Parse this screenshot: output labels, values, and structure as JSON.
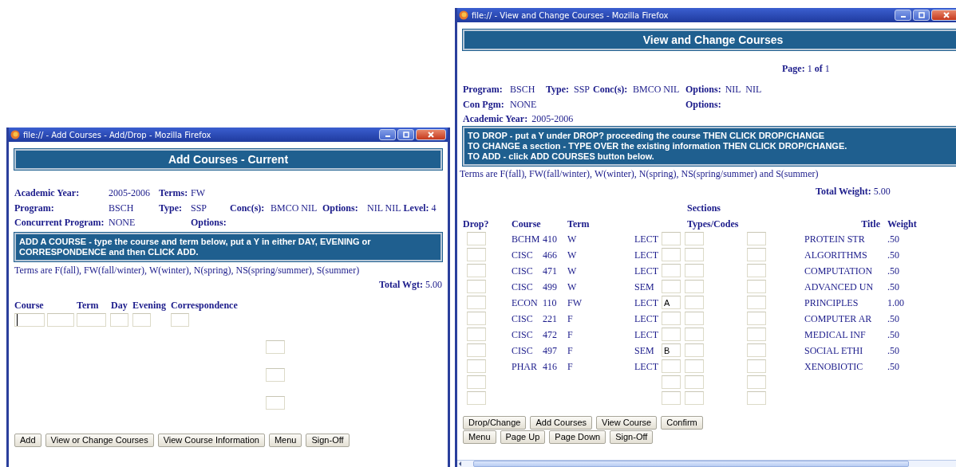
{
  "add_window": {
    "title": "file:// - Add Courses - Add/Drop - Mozilla Firefox",
    "heading": "Add Courses - Current",
    "info_rows": [
      {
        "cells": [
          {
            "kind": "pair",
            "label": "Academic Year:",
            "value": "2005-2006"
          },
          {
            "kind": "pair",
            "label": "Terms:",
            "value": "FW"
          }
        ]
      },
      {
        "cells": [
          {
            "kind": "pair",
            "label": "Program:",
            "value": "BSCH"
          },
          {
            "kind": "pair",
            "label": "Type:",
            "value": "SSP"
          },
          {
            "kind": "pair",
            "label": "Conc(s):",
            "value": "BMCO NIL"
          },
          {
            "kind": "pair",
            "label": "Options:",
            "value": "NIL NIL"
          },
          {
            "kind": "pair",
            "label": "Level:",
            "value": "4"
          }
        ]
      },
      {
        "cells": [
          {
            "kind": "pair",
            "label": "Concurrent Program:",
            "value": "NONE"
          },
          {
            "kind": "spacer"
          },
          {
            "kind": "pair",
            "label": "Options:"
          }
        ]
      }
    ],
    "instruction": "ADD A COURSE - type the course and term below, put a Y in either DAY, EVENING or CORRESPONDENCE and then CLICK ADD.",
    "terms_note": "Terms are F(fall), FW(fall/winter), W(winter), N(spring), NS(spring/summer), S(summer)",
    "total": "**Total Wgt:** 5.00",
    "form_labels": [
      {
        "kind": "course",
        "text": "Course"
      },
      {
        "kind": "term",
        "text": "Term"
      },
      {
        "kind": "day",
        "text": "Day"
      },
      {
        "kind": "evening",
        "text": "Evening"
      },
      {
        "kind": "correspondence",
        "text": "Correspondence"
      }
    ],
    "form_fields": [
      {
        "kind": "course_subject",
        "focused": true
      },
      {
        "kind": "course_number",
        "focused": false
      },
      {
        "kind": "term",
        "focused": false
      },
      {
        "kind": "day",
        "focused": false
      },
      {
        "kind": "evening",
        "focused": false
      },
      {
        "kind": "correspondence",
        "focused": false
      }
    ],
    "extra_fields": [
      {
        "kind": "text"
      },
      {
        "kind": "text"
      },
      {
        "kind": "text"
      }
    ],
    "buttons": [
      "Add",
      "View or Change Courses",
      "View Course Information",
      "Menu",
      "Sign-Off"
    ]
  },
  "view_window": {
    "title": "file:// - View and Change Courses - Mozilla Firefox",
    "heading": "View and Change Courses",
    "page": "**Page:** 1 **of** 1",
    "info_rows": [
      {
        "cells": [
          {
            "kind": "pair",
            "label": "Program:",
            "value": "BSCH"
          },
          {
            "kind": "pair",
            "label": "Type:",
            "value": "SSP"
          },
          {
            "kind": "pair",
            "label": "Conc(s):",
            "value": "BMCO NIL"
          },
          {
            "kind": "pair",
            "label": "Options:",
            "value": "NIL  NIL"
          }
        ]
      },
      {
        "cells": [
          {
            "kind": "pair",
            "label": "Con Pgm:",
            "value": "NONE"
          },
          {
            "kind": "spacer"
          },
          {
            "kind": "pair",
            "label": "Options:"
          }
        ]
      },
      {
        "cells": [
          {
            "kind": "pair",
            "label": "Academic Year:",
            "value": "2005-2006"
          }
        ]
      }
    ],
    "instructions": [
      "TO DROP - put a Y under DROP? proceeding the course THEN CLICK DROP/CHANGE",
      "TO CHANGE a section - TYPE OVER the existing information THEN CLICK DROP/CHANGE.",
      "TO ADD - click ADD COURSES button below."
    ],
    "terms_note": "Terms are F(fall), FW(fall/winter), W(winter), N(spring), NS(spring/summer) and S(summer)",
    "total": "**Total Weight:** 5.00",
    "sections_heading": "Sections",
    "columns": {
      "drop": "Drop?",
      "course": "Course",
      "term": "Term",
      "types": "Types/Codes",
      "title": "Title",
      "weight": "Weight"
    },
    "rows": [
      {
        "kind": "course",
        "subject": "BCHM",
        "number": "410",
        "term": "W",
        "type": "LECT",
        "title": "PROTEIN STR",
        "weight": ".50"
      },
      {
        "kind": "course",
        "subject": "CISC",
        "number": "466",
        "term": "W",
        "type": "LECT",
        "title": "ALGORITHMS",
        "weight": ".50"
      },
      {
        "kind": "course",
        "subject": "CISC",
        "number": "471",
        "term": "W",
        "type": "LECT",
        "title": "COMPUTATION",
        "weight": ".50"
      },
      {
        "kind": "course",
        "subject": "CISC",
        "number": "499",
        "term": "W",
        "type": "SEM",
        "title": "ADVANCED UN",
        "weight": ".50"
      },
      {
        "kind": "course",
        "subject": "ECON",
        "number": "110",
        "term": "FW",
        "type": "LECT",
        "section": "A",
        "title": "PRINCIPLES",
        "weight": "1.00"
      },
      {
        "kind": "course",
        "subject": "CISC",
        "number": "221",
        "term": "F",
        "type": "LECT",
        "title": "COMPUTER AR",
        "weight": ".50"
      },
      {
        "kind": "course",
        "subject": "CISC",
        "number": "472",
        "term": "F",
        "type": "LECT",
        "title": "MEDICAL INF",
        "weight": ".50"
      },
      {
        "kind": "course",
        "subject": "CISC",
        "number": "497",
        "term": "F",
        "type": "SEM",
        "section": "B",
        "title": "SOCIAL ETHI",
        "weight": ".50"
      },
      {
        "kind": "course",
        "subject": "PHAR",
        "number": "416",
        "term": "F",
        "type": "LECT",
        "title": "XENOBIOTIC",
        "weight": ".50"
      },
      {
        "kind": "blank"
      },
      {
        "kind": "blank"
      }
    ],
    "button_rows": [
      [
        "Drop/Change",
        "Add Courses",
        "View Course",
        "Confirm"
      ],
      [
        "Menu",
        "Page Up",
        "Page Down",
        "Sign-Off"
      ]
    ]
  }
}
